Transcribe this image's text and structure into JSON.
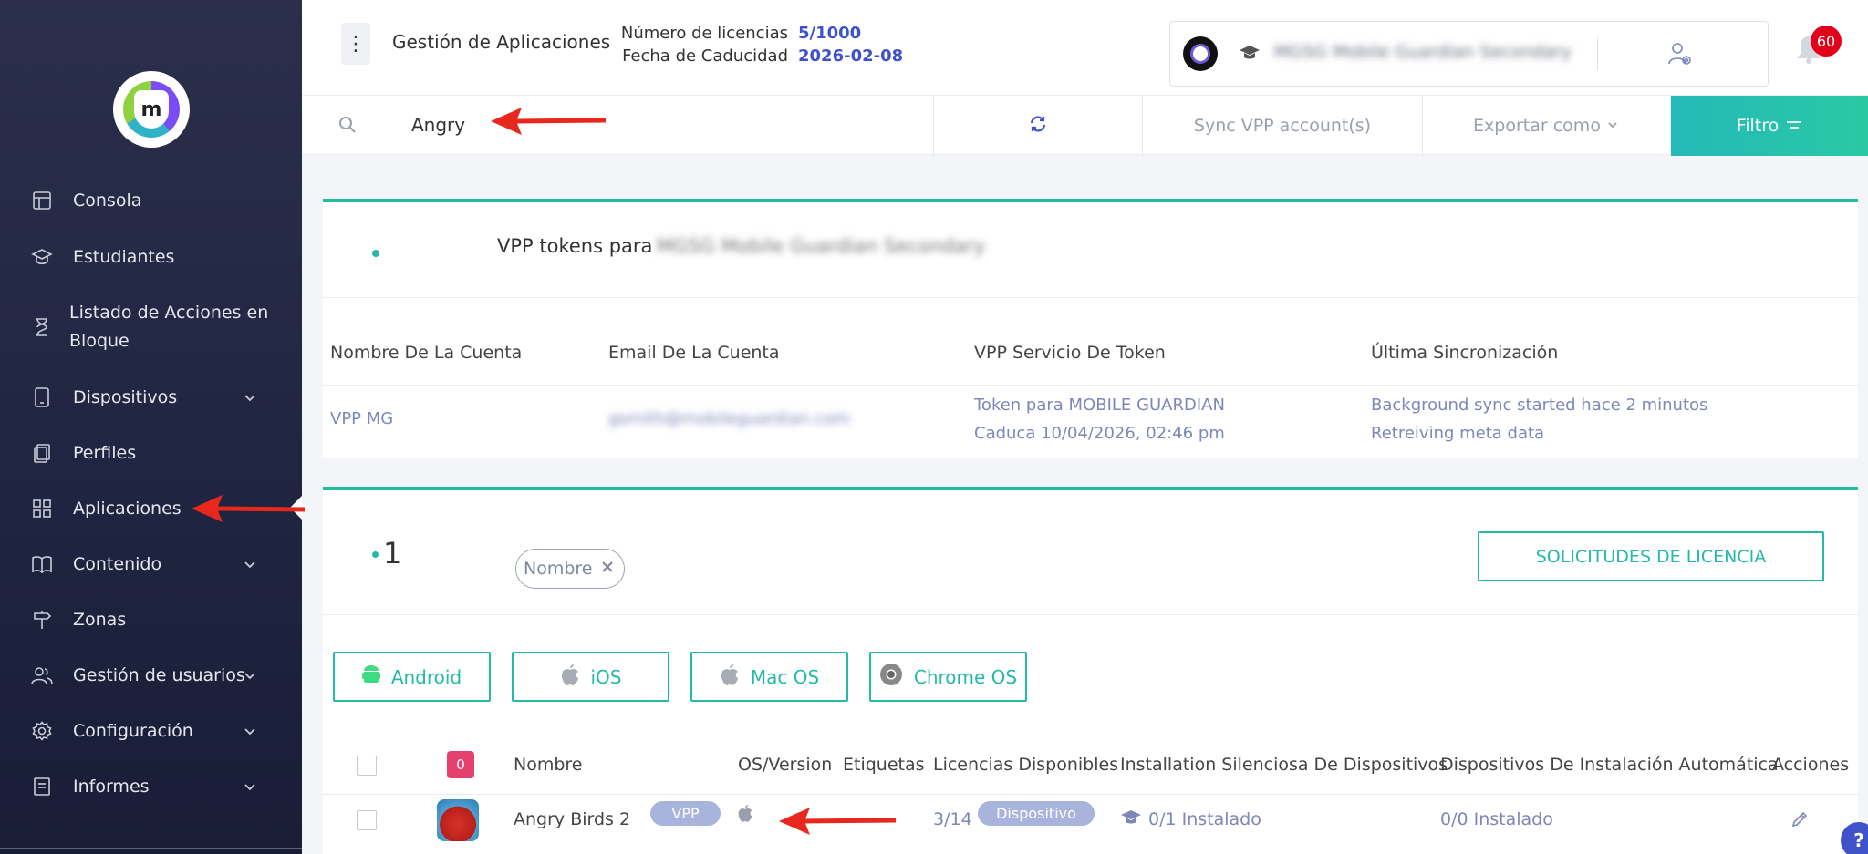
{
  "sidebar": {
    "logo_letter": "m",
    "items": [
      {
        "label": "Consola",
        "icon": "layout-icon",
        "chevron": false
      },
      {
        "label": "Estudiantes",
        "icon": "graduation-cap-icon",
        "chevron": false
      },
      {
        "label": "Listado de Acciones en Bloque",
        "icon": "hourglass-icon",
        "chevron": false
      },
      {
        "label": "Dispositivos",
        "icon": "tablet-icon",
        "chevron": true
      },
      {
        "label": "Perfiles",
        "icon": "profiles-icon",
        "chevron": false
      },
      {
        "label": "Aplicaciones",
        "icon": "apps-grid-icon",
        "chevron": false
      },
      {
        "label": "Contenido",
        "icon": "book-icon",
        "chevron": true
      },
      {
        "label": "Zonas",
        "icon": "signpost-icon",
        "chevron": false
      },
      {
        "label": "Gestión de usuarios",
        "icon": "users-icon",
        "chevron": true
      },
      {
        "label": "Configuración",
        "icon": "gear-icon",
        "chevron": true
      },
      {
        "label": "Informes",
        "icon": "report-icon",
        "chevron": true
      }
    ]
  },
  "header": {
    "app_title": "Gestión de Aplicaciones",
    "licenses_label": "Número de licencias",
    "licenses_value": "5/1000",
    "expiry_label": "Fecha de Caducidad",
    "expiry_value": "2026-02-08",
    "school_name": "MGSG Mobile Guardian Secondary",
    "notifications_count": "60"
  },
  "toolbar": {
    "search_value": "Angry",
    "sync_label": "Sync VPP account(s)",
    "export_label": "Exportar como",
    "filter_label": "Filtro"
  },
  "vpp": {
    "title": "VPP tokens para",
    "school_name": "MGSG Mobile Guardian Secondary",
    "columns": [
      "Nombre De La Cuenta",
      "Email De La Cuenta",
      "VPP Servicio De Token",
      "Última Sincronización"
    ],
    "row": {
      "account_name": "VPP MG",
      "email": "gsmith@mobileguardian.com",
      "token_line1": "Token para MOBILE GUARDIAN",
      "token_line2": "Caduca 10/04/2026, 02:46 pm",
      "sync_line1": "Background sync started hace 2 minutos",
      "sync_line2": "Retreiving meta data"
    }
  },
  "apps": {
    "count": "1",
    "filter_chip": "Nombre",
    "license_requests_label": "SOLICITUDES DE LICENCIA",
    "os_buttons": [
      {
        "label": "Android",
        "icon": "android-icon"
      },
      {
        "label": "iOS",
        "icon": "apple-icon"
      },
      {
        "label": "Mac OS",
        "icon": "apple-icon"
      },
      {
        "label": "Chrome OS",
        "icon": "chrome-icon"
      }
    ],
    "selected_count": "0",
    "columns": {
      "name": "Nombre",
      "os": "OS/Version",
      "tags": "Etiquetas",
      "licenses": "Licencias Disponibles",
      "silent": "Installation Silenciosa De Dispositivos",
      "auto": "Dispositivos De Instalación Automática",
      "actions": "Acciones"
    },
    "rows": [
      {
        "name": "Angry Birds 2",
        "badge": "VPP",
        "os_icon": "apple-icon",
        "licenses": "3/14",
        "license_type": "Dispositivo",
        "silent": "0/1 Instalado",
        "auto": "0/0 Instalado"
      }
    ]
  },
  "colors": {
    "accent": "#25b9a8",
    "link": "#3f52c9",
    "sidebar_bg": "#1f2440",
    "badge_red": "#e3001b",
    "annotation_arrow": "#e8281c"
  }
}
